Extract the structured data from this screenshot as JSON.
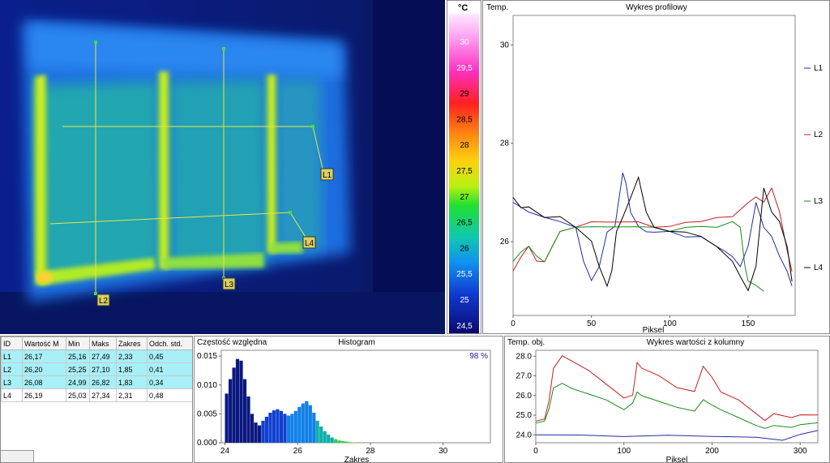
{
  "colors": {
    "L1": "#1f2fa0",
    "L2": "#c81e1e",
    "L3": "#1a8a1a",
    "L4": "#000000",
    "marker": "#e6e650"
  },
  "thermal": {
    "markers": [
      {
        "id": "L1",
        "label": "L1"
      },
      {
        "id": "L2",
        "label": "L2"
      },
      {
        "id": "L3",
        "label": "L3"
      },
      {
        "id": "L4",
        "label": "L4"
      }
    ]
  },
  "scale": {
    "unit": "°C",
    "ticks": [
      "30",
      "29,5",
      "29",
      "28,5",
      "28",
      "27,5",
      "27",
      "26,5",
      "26",
      "25,5",
      "25",
      "24,5"
    ]
  },
  "profile": {
    "ylabel": "Temp.",
    "title": "Wykres profilowy",
    "xlabel": "Piksel",
    "yticks": [
      "30",
      "28",
      "26"
    ],
    "xticks": [
      "0",
      "50",
      "100",
      "150"
    ],
    "legend": [
      "L1",
      "L2",
      "L3",
      "L4"
    ]
  },
  "table": {
    "headers": [
      "ID",
      "Wartość M",
      "Min",
      "Maks",
      "Zakres",
      "Odch. std."
    ],
    "rows": [
      [
        "L1",
        "26,17",
        "25,16",
        "27,49",
        "2,33",
        "0,45"
      ],
      [
        "L2",
        "26,20",
        "25,25",
        "27,10",
        "1,85",
        "0,41"
      ],
      [
        "L3",
        "26,08",
        "24,99",
        "26,82",
        "1,83",
        "0,34"
      ],
      [
        "L4",
        "26,19",
        "25,03",
        "27,34",
        "2,31",
        "0,48"
      ]
    ]
  },
  "histogram": {
    "ylabel": "Częstość względna",
    "title": "Histogram",
    "percent": "98 %",
    "xlabel": "Zakres",
    "yticks": [
      "0.015",
      "0.010",
      "0.005",
      "0.000"
    ],
    "xticks": [
      "24",
      "26",
      "28",
      "30"
    ]
  },
  "column": {
    "ylabel": "Temp. obj.",
    "title": "Wykres wartości z kolumny",
    "xlabel": "Piksel",
    "yticks": [
      "28.0",
      "27.0",
      "26.0",
      "25.0",
      "24.0"
    ],
    "xticks": [
      "0",
      "100",
      "200",
      "300"
    ]
  },
  "chart_data": [
    {
      "type": "line",
      "title": "Wykres profilowy",
      "xlabel": "Piksel",
      "ylabel": "Temp.",
      "xlim": [
        0,
        180
      ],
      "ylim": [
        24.5,
        30.6
      ],
      "series": [
        {
          "name": "L1",
          "x": [
            0,
            10,
            20,
            30,
            40,
            45,
            50,
            55,
            60,
            65,
            70,
            72,
            75,
            80,
            85,
            90,
            100,
            110,
            120,
            130,
            135,
            140,
            145,
            150,
            155,
            160,
            165,
            170,
            175,
            178
          ],
          "y": [
            26.8,
            26.6,
            26.5,
            26.4,
            26.3,
            25.6,
            25.2,
            25.5,
            26.2,
            26.3,
            27.4,
            27.2,
            26.6,
            26.3,
            26.2,
            26.2,
            26.2,
            26.1,
            26.1,
            25.9,
            25.8,
            25.7,
            25.5,
            25.9,
            26.8,
            26.3,
            26.1,
            25.7,
            25.4,
            25.1
          ]
        },
        {
          "name": "L2",
          "x": [
            0,
            5,
            10,
            15,
            20,
            25,
            30,
            40,
            50,
            60,
            70,
            80,
            90,
            100,
            110,
            120,
            130,
            140,
            150,
            155,
            160,
            165,
            170,
            175,
            178
          ],
          "y": [
            25.4,
            25.7,
            25.9,
            25.6,
            25.6,
            25.9,
            26.2,
            26.3,
            26.4,
            26.4,
            26.4,
            26.4,
            26.3,
            26.3,
            26.4,
            26.4,
            26.5,
            26.5,
            26.8,
            26.9,
            26.8,
            27.1,
            26.6,
            25.8,
            25.4
          ]
        },
        {
          "name": "L3",
          "x": [
            0,
            5,
            10,
            15,
            20,
            25,
            30,
            40,
            50,
            60,
            70,
            80,
            90,
            100,
            110,
            120,
            130,
            140,
            145,
            148,
            150,
            155,
            160
          ],
          "y": [
            25.6,
            25.8,
            25.9,
            25.7,
            25.6,
            25.9,
            26.2,
            26.3,
            26.3,
            26.3,
            26.3,
            26.3,
            26.3,
            26.2,
            26.3,
            26.3,
            26.3,
            26.4,
            26.3,
            25.5,
            25.2,
            25.1,
            25.0
          ]
        },
        {
          "name": "L4",
          "x": [
            0,
            5,
            10,
            20,
            30,
            40,
            50,
            55,
            60,
            63,
            66,
            70,
            75,
            80,
            85,
            90,
            100,
            110,
            120,
            130,
            140,
            145,
            150,
            155,
            160,
            165,
            170,
            175,
            178
          ],
          "y": [
            26.9,
            26.7,
            26.7,
            26.5,
            26.5,
            26.3,
            26.0,
            25.5,
            25.1,
            25.4,
            26.2,
            26.5,
            26.9,
            27.3,
            26.6,
            26.3,
            26.2,
            26.2,
            26.1,
            25.9,
            25.6,
            25.3,
            25.0,
            25.5,
            27.1,
            26.6,
            26.4,
            25.9,
            25.2
          ]
        }
      ]
    },
    {
      "type": "bar",
      "title": "Histogram",
      "xlabel": "Zakres",
      "ylabel": "Częstość względna",
      "xlim": [
        23.9,
        31.3
      ],
      "ylim": [
        0,
        0.016
      ],
      "x": [
        24.0,
        24.1,
        24.2,
        24.3,
        24.4,
        24.5,
        24.6,
        24.7,
        24.8,
        24.9,
        25.0,
        25.1,
        25.2,
        25.3,
        25.4,
        25.5,
        25.6,
        25.7,
        25.8,
        25.9,
        26.0,
        26.1,
        26.2,
        26.3,
        26.4,
        26.5,
        26.6,
        26.7,
        26.8,
        26.9,
        27.0,
        27.1,
        27.2,
        27.3,
        27.4,
        27.5,
        27.6,
        27.7
      ],
      "values": [
        0.0085,
        0.011,
        0.013,
        0.0145,
        0.0142,
        0.011,
        0.008,
        0.005,
        0.0035,
        0.003,
        0.0038,
        0.0045,
        0.0052,
        0.0056,
        0.0058,
        0.0055,
        0.005,
        0.0047,
        0.005,
        0.0055,
        0.0062,
        0.0068,
        0.0072,
        0.0065,
        0.0052,
        0.0038,
        0.0028,
        0.002,
        0.0014,
        0.0009,
        0.0006,
        0.0004,
        0.0003,
        0.0002,
        0.0001,
        5e-05,
        3e-05,
        1e-05
      ]
    },
    {
      "type": "line",
      "title": "Wykres wartości z kolumny",
      "xlabel": "Piksel",
      "ylabel": "Temp. obj.",
      "xlim": [
        0,
        320
      ],
      "ylim": [
        23.6,
        28.3
      ],
      "series": [
        {
          "name": "L1",
          "x": [
            0,
            50,
            100,
            150,
            200,
            250,
            280,
            300,
            320
          ],
          "y": [
            24.0,
            24.0,
            23.9,
            24.0,
            23.9,
            23.9,
            23.7,
            24.0,
            24.2
          ]
        },
        {
          "name": "L2",
          "x": [
            0,
            10,
            15,
            20,
            30,
            40,
            60,
            80,
            100,
            110,
            115,
            120,
            140,
            160,
            180,
            190,
            200,
            210,
            230,
            250,
            260,
            270,
            290,
            300,
            320
          ],
          "y": [
            24.7,
            24.8,
            25.7,
            27.4,
            28.0,
            27.8,
            27.3,
            26.6,
            25.9,
            26.0,
            27.7,
            27.4,
            27.0,
            26.4,
            26.2,
            27.5,
            26.9,
            26.2,
            25.8,
            25.1,
            24.7,
            25.1,
            24.9,
            25.0,
            25.0
          ]
        },
        {
          "name": "L3",
          "x": [
            0,
            10,
            15,
            20,
            30,
            40,
            60,
            80,
            100,
            110,
            115,
            120,
            140,
            160,
            180,
            190,
            200,
            210,
            230,
            250,
            260,
            270,
            290,
            300,
            320
          ],
          "y": [
            24.6,
            24.7,
            25.3,
            26.4,
            26.6,
            26.4,
            26.1,
            25.8,
            25.3,
            25.6,
            26.2,
            26.0,
            25.7,
            25.4,
            25.2,
            25.8,
            25.5,
            25.3,
            24.9,
            24.5,
            24.3,
            24.5,
            24.4,
            24.5,
            24.6
          ]
        }
      ]
    }
  ]
}
